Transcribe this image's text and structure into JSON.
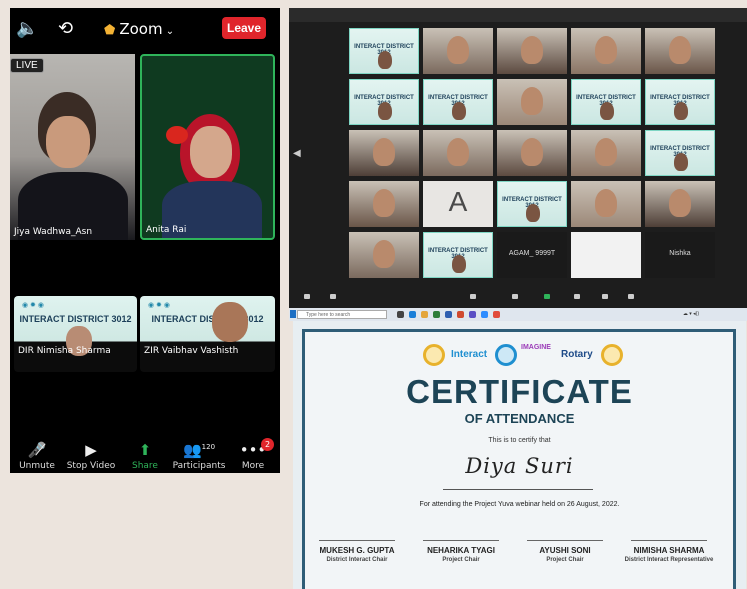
{
  "phone": {
    "meeting_title": "Zoom",
    "leave_label": "Leave",
    "live_label": "LIVE",
    "tiles": [
      {
        "name": "Jiya Wadhwa_Asn"
      },
      {
        "name": "Anita Rai"
      },
      {
        "name": "DIR Nimisha Sharma",
        "banner": "INTERACT DISTRICT 3012"
      },
      {
        "name": "ZIR Vaibhav Vashisth",
        "banner": "INTERACT DISTRICT 3012"
      }
    ],
    "toolbar": [
      {
        "label": "Unmute",
        "icon": "mic-muted-icon"
      },
      {
        "label": "Stop Video",
        "icon": "video-camera-icon"
      },
      {
        "label": "Share",
        "icon": "share-screen-icon"
      },
      {
        "label": "Participants",
        "icon": "participants-icon",
        "count": "120"
      },
      {
        "label": "More",
        "icon": "more-icon",
        "badge": "2"
      }
    ]
  },
  "gallery": {
    "plain_names": {
      "agam": "AGAM_ 9999T",
      "nishka": "Nishka"
    },
    "avatar_letter": "A",
    "banner_text": "INTERACT DISTRICT 3012"
  },
  "taskbar": {
    "search_placeholder": "Type here to search"
  },
  "certificate": {
    "logos": {
      "interact": "Interact",
      "imagine": "IMAGINE",
      "rotary": "Rotary"
    },
    "title": "CERTIFICATE",
    "subtitle": "OF ATTENDANCE",
    "certify_text": "This is to certify that",
    "recipient": "Diya Suri",
    "attendance_text": "For attending the Project Yuva webinar held on 26 August, 2022.",
    "signatories": [
      {
        "name": "MUKESH G. GUPTA",
        "role": "District Interact Chair"
      },
      {
        "name": "NEHARIKA TYAGI",
        "role": "Project Chair"
      },
      {
        "name": "AYUSHI SONI",
        "role": "Project Chair"
      },
      {
        "name": "NIMISHA SHARMA",
        "role": "District Interact Representative"
      }
    ]
  }
}
